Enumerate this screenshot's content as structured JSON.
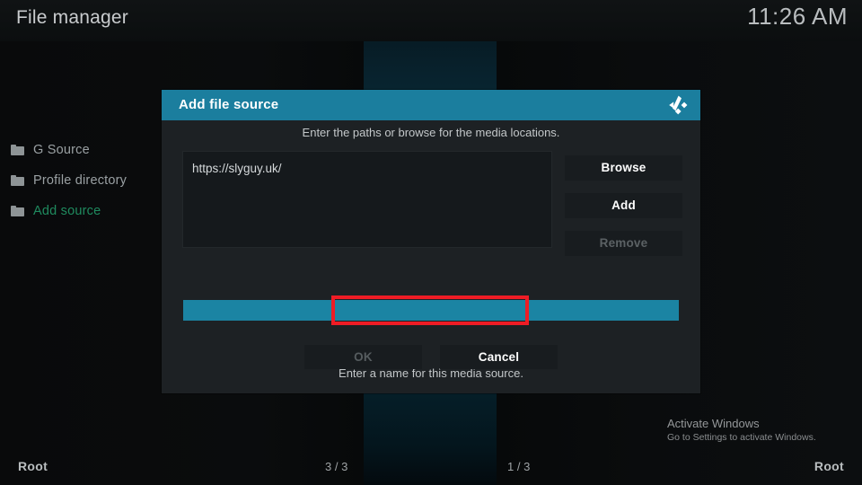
{
  "header": {
    "title": "File manager",
    "clock": "11:26 AM"
  },
  "sidebar": {
    "items": [
      {
        "label": "G Source",
        "icon": "folder-icon",
        "selected": false
      },
      {
        "label": "Profile directory",
        "icon": "folder-icon",
        "selected": false
      },
      {
        "label": "Add source",
        "icon": "folder-icon",
        "selected": true
      }
    ]
  },
  "dialog": {
    "title": "Add file source",
    "logo_icon": "kodi-logo-icon",
    "paths_hint": "Enter the paths or browse for the media locations.",
    "path_entries": [
      "https://slyguy.uk/"
    ],
    "side_buttons": [
      {
        "label": "Browse",
        "disabled": false
      },
      {
        "label": "Add",
        "disabled": false
      },
      {
        "label": "Remove",
        "disabled": true
      }
    ],
    "name_hint": "Enter a name for this media source.",
    "name_value": "",
    "bottom_buttons": [
      {
        "label": "OK",
        "disabled": true
      },
      {
        "label": "Cancel",
        "disabled": false
      }
    ]
  },
  "annotation": {
    "color": "#ee1c25"
  },
  "watermark": {
    "title": "Activate Windows",
    "subtitle": "Go to Settings to activate Windows."
  },
  "bottom_bar": {
    "left_label": "Root",
    "left_count": "3 / 3",
    "right_count": "1 / 3",
    "right_label": "Root"
  },
  "colors": {
    "accent_teal": "#1b7e9e",
    "field_teal": "#1b84a3",
    "selected_green": "#1f8b5f",
    "annotation_red": "#ee1c25"
  }
}
